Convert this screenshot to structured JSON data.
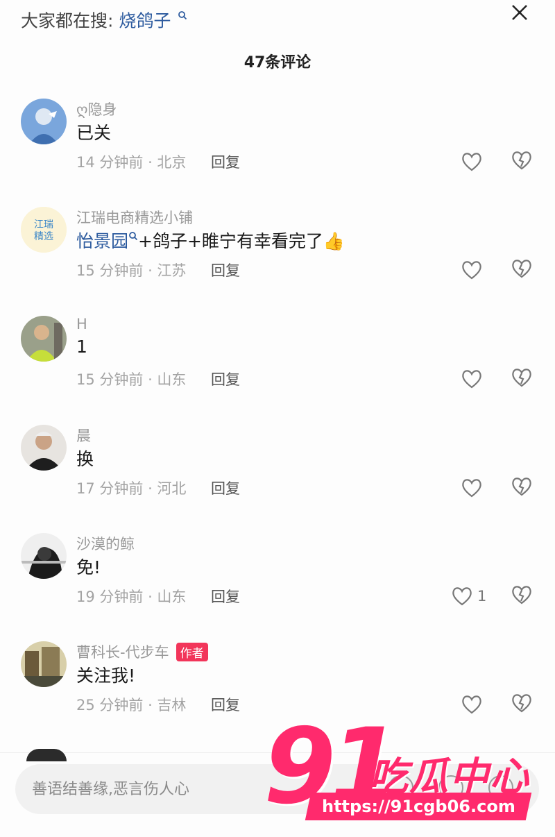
{
  "search_hint": {
    "label": "大家都在搜:",
    "keyword": "烧鸽子"
  },
  "comment_count_title": "47条评论",
  "comments": [
    {
      "username": "ღ隐身",
      "text": "已关",
      "meta": "14 分钟前 · 北京",
      "reply_label": "回复",
      "likes": ""
    },
    {
      "username": "江瑞电商精选小铺",
      "avatar_text": "江瑞\n精选",
      "text_link": "怡景园",
      "text_rest": "+鸽子+睢宁有幸看完了",
      "text_emoji": "👍",
      "meta": "15 分钟前 · 江苏",
      "reply_label": "回复",
      "likes": ""
    },
    {
      "username": "H",
      "text": "1",
      "meta": "15 分钟前 · 山东",
      "reply_label": "回复",
      "likes": ""
    },
    {
      "username": "晨",
      "text": "换",
      "meta": "17 分钟前 · 河北",
      "reply_label": "回复",
      "likes": ""
    },
    {
      "username": "沙漠的鲸",
      "text": "免!",
      "meta": "19 分钟前 · 山东",
      "reply_label": "回复",
      "likes": "1"
    },
    {
      "username": "曹科长-代步车",
      "badge": "作者",
      "text": "关注我!",
      "meta": "25 分钟前 · 吉林",
      "reply_label": "回复",
      "likes": ""
    }
  ],
  "input": {
    "placeholder": "善语结善缘,恶言伤人心"
  },
  "watermark": {
    "big": "91",
    "name": "吃瓜中心",
    "url": "https://91cgb06.com"
  },
  "colors": {
    "link": "#2c5a9e",
    "badge": "#f2355a",
    "watermark": "#ff2a6d"
  }
}
